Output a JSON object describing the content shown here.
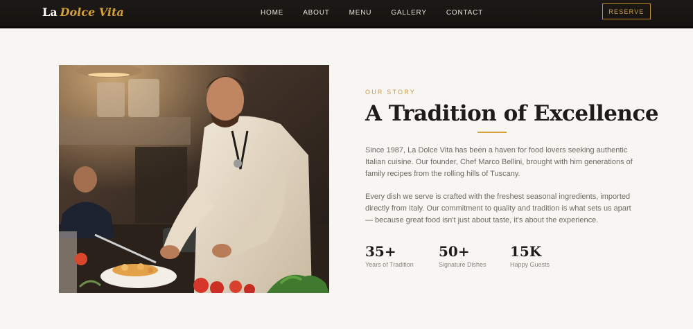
{
  "nav": {
    "brand_main": "La",
    "brand_accent": "Dolce Vita",
    "links": [
      "HOME",
      "ABOUT",
      "MENU",
      "GALLERY",
      "CONTACT"
    ],
    "reserve_label": "RESERVE"
  },
  "story": {
    "eyebrow": "OUR STORY",
    "title": "A Tradition of Excellence",
    "paragraph1": "Since 1987, La Dolce Vita has been a haven for food lovers seeking authentic Italian cuisine. Our founder, Chef Marco Bellini, brought with him generations of family recipes from the rolling hills of Tuscany.",
    "paragraph2": "Every dish we serve is crafted with the freshest seasonal ingredients, imported directly from Italy. Our commitment to quality and tradition is what sets us apart — because great food isn't just about taste, it's about the experience.",
    "stats": [
      {
        "value": "35+",
        "label": "Years of Tradition"
      },
      {
        "value": "50+",
        "label": "Signature Dishes"
      },
      {
        "value": "15K",
        "label": "Happy Guests"
      }
    ]
  },
  "colors": {
    "accent": "#d4a03a",
    "nav_bg": "#1d1916",
    "page_bg": "#f8f6f3",
    "heading": "#1f1b18"
  }
}
